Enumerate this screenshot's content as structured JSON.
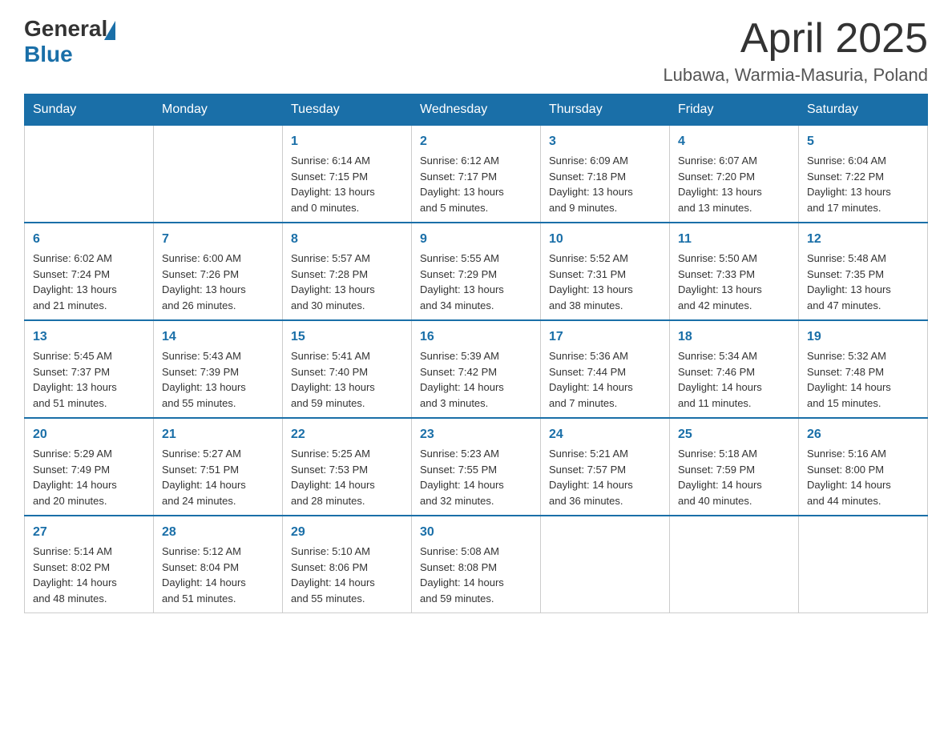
{
  "header": {
    "logo_text_general": "General",
    "logo_text_blue": "Blue",
    "page_title": "April 2025",
    "subtitle": "Lubawa, Warmia-Masuria, Poland"
  },
  "calendar": {
    "days_of_week": [
      "Sunday",
      "Monday",
      "Tuesday",
      "Wednesday",
      "Thursday",
      "Friday",
      "Saturday"
    ],
    "weeks": [
      [
        {
          "day": "",
          "info": ""
        },
        {
          "day": "",
          "info": ""
        },
        {
          "day": "1",
          "info": "Sunrise: 6:14 AM\nSunset: 7:15 PM\nDaylight: 13 hours\nand 0 minutes."
        },
        {
          "day": "2",
          "info": "Sunrise: 6:12 AM\nSunset: 7:17 PM\nDaylight: 13 hours\nand 5 minutes."
        },
        {
          "day": "3",
          "info": "Sunrise: 6:09 AM\nSunset: 7:18 PM\nDaylight: 13 hours\nand 9 minutes."
        },
        {
          "day": "4",
          "info": "Sunrise: 6:07 AM\nSunset: 7:20 PM\nDaylight: 13 hours\nand 13 minutes."
        },
        {
          "day": "5",
          "info": "Sunrise: 6:04 AM\nSunset: 7:22 PM\nDaylight: 13 hours\nand 17 minutes."
        }
      ],
      [
        {
          "day": "6",
          "info": "Sunrise: 6:02 AM\nSunset: 7:24 PM\nDaylight: 13 hours\nand 21 minutes."
        },
        {
          "day": "7",
          "info": "Sunrise: 6:00 AM\nSunset: 7:26 PM\nDaylight: 13 hours\nand 26 minutes."
        },
        {
          "day": "8",
          "info": "Sunrise: 5:57 AM\nSunset: 7:28 PM\nDaylight: 13 hours\nand 30 minutes."
        },
        {
          "day": "9",
          "info": "Sunrise: 5:55 AM\nSunset: 7:29 PM\nDaylight: 13 hours\nand 34 minutes."
        },
        {
          "day": "10",
          "info": "Sunrise: 5:52 AM\nSunset: 7:31 PM\nDaylight: 13 hours\nand 38 minutes."
        },
        {
          "day": "11",
          "info": "Sunrise: 5:50 AM\nSunset: 7:33 PM\nDaylight: 13 hours\nand 42 minutes."
        },
        {
          "day": "12",
          "info": "Sunrise: 5:48 AM\nSunset: 7:35 PM\nDaylight: 13 hours\nand 47 minutes."
        }
      ],
      [
        {
          "day": "13",
          "info": "Sunrise: 5:45 AM\nSunset: 7:37 PM\nDaylight: 13 hours\nand 51 minutes."
        },
        {
          "day": "14",
          "info": "Sunrise: 5:43 AM\nSunset: 7:39 PM\nDaylight: 13 hours\nand 55 minutes."
        },
        {
          "day": "15",
          "info": "Sunrise: 5:41 AM\nSunset: 7:40 PM\nDaylight: 13 hours\nand 59 minutes."
        },
        {
          "day": "16",
          "info": "Sunrise: 5:39 AM\nSunset: 7:42 PM\nDaylight: 14 hours\nand 3 minutes."
        },
        {
          "day": "17",
          "info": "Sunrise: 5:36 AM\nSunset: 7:44 PM\nDaylight: 14 hours\nand 7 minutes."
        },
        {
          "day": "18",
          "info": "Sunrise: 5:34 AM\nSunset: 7:46 PM\nDaylight: 14 hours\nand 11 minutes."
        },
        {
          "day": "19",
          "info": "Sunrise: 5:32 AM\nSunset: 7:48 PM\nDaylight: 14 hours\nand 15 minutes."
        }
      ],
      [
        {
          "day": "20",
          "info": "Sunrise: 5:29 AM\nSunset: 7:49 PM\nDaylight: 14 hours\nand 20 minutes."
        },
        {
          "day": "21",
          "info": "Sunrise: 5:27 AM\nSunset: 7:51 PM\nDaylight: 14 hours\nand 24 minutes."
        },
        {
          "day": "22",
          "info": "Sunrise: 5:25 AM\nSunset: 7:53 PM\nDaylight: 14 hours\nand 28 minutes."
        },
        {
          "day": "23",
          "info": "Sunrise: 5:23 AM\nSunset: 7:55 PM\nDaylight: 14 hours\nand 32 minutes."
        },
        {
          "day": "24",
          "info": "Sunrise: 5:21 AM\nSunset: 7:57 PM\nDaylight: 14 hours\nand 36 minutes."
        },
        {
          "day": "25",
          "info": "Sunrise: 5:18 AM\nSunset: 7:59 PM\nDaylight: 14 hours\nand 40 minutes."
        },
        {
          "day": "26",
          "info": "Sunrise: 5:16 AM\nSunset: 8:00 PM\nDaylight: 14 hours\nand 44 minutes."
        }
      ],
      [
        {
          "day": "27",
          "info": "Sunrise: 5:14 AM\nSunset: 8:02 PM\nDaylight: 14 hours\nand 48 minutes."
        },
        {
          "day": "28",
          "info": "Sunrise: 5:12 AM\nSunset: 8:04 PM\nDaylight: 14 hours\nand 51 minutes."
        },
        {
          "day": "29",
          "info": "Sunrise: 5:10 AM\nSunset: 8:06 PM\nDaylight: 14 hours\nand 55 minutes."
        },
        {
          "day": "30",
          "info": "Sunrise: 5:08 AM\nSunset: 8:08 PM\nDaylight: 14 hours\nand 59 minutes."
        },
        {
          "day": "",
          "info": ""
        },
        {
          "day": "",
          "info": ""
        },
        {
          "day": "",
          "info": ""
        }
      ]
    ]
  }
}
